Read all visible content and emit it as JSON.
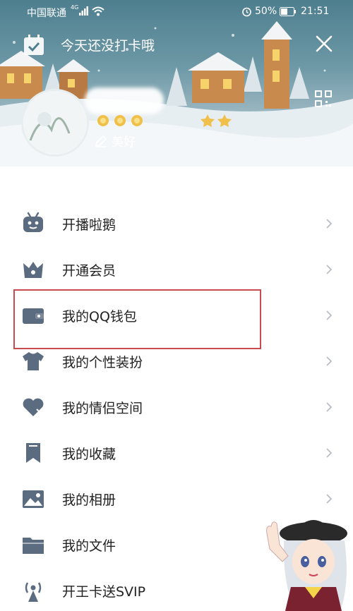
{
  "status_bar": {
    "carrier": "中国联通",
    "network": "4G",
    "battery": "50%",
    "time": "21:51"
  },
  "header": {
    "checkin_text": "今天还没打卡哦",
    "signature": "美好"
  },
  "menu": {
    "items": [
      {
        "label": "开播啦鹅",
        "icon": "robot-tv-icon"
      },
      {
        "label": "开通会员",
        "icon": "crown-icon"
      },
      {
        "label": "我的QQ钱包",
        "icon": "wallet-icon"
      },
      {
        "label": "我的个性装扮",
        "icon": "tshirt-icon"
      },
      {
        "label": "我的情侣空间",
        "icon": "heart-icon"
      },
      {
        "label": "我的收藏",
        "icon": "bookmark-icon"
      },
      {
        "label": "我的相册",
        "icon": "photo-icon"
      },
      {
        "label": "我的文件",
        "icon": "folder-icon"
      },
      {
        "label": "开王卡送SVIP",
        "icon": "signal-tower-icon"
      }
    ]
  },
  "colors": {
    "icon_gray": "#5b6b80",
    "highlight": "#c94a4f",
    "header_teal": "#4e7f8f"
  }
}
